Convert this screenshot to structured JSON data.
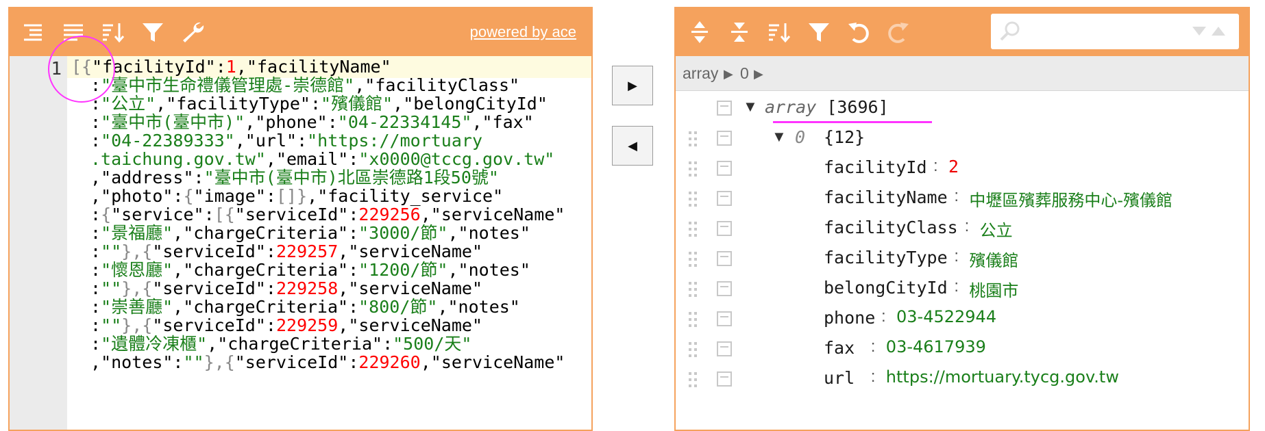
{
  "left_panel": {
    "powered_by": "powered by ace",
    "toolbar": {
      "format_icon": "format-icon",
      "compact_icon": "compact-icon",
      "sort_icon": "sort-icon",
      "filter_icon": "filter-icon",
      "repair_icon": "wrench-icon"
    },
    "line_number": "1"
  },
  "transfer": {
    "to_right": "▶",
    "to_left": "◀"
  },
  "right_panel": {
    "toolbar": {
      "expand_icon": "expand-all-icon",
      "collapse_icon": "collapse-all-icon",
      "sort_icon": "sort-icon",
      "filter_icon": "filter-icon",
      "undo_icon": "undo-icon",
      "redo_icon": "redo-icon"
    },
    "search": {
      "placeholder": "",
      "value": ""
    },
    "breadcrumb": [
      "array",
      "▶",
      "0",
      "▶"
    ],
    "tree": {
      "root": {
        "toggle": "▼",
        "name": "array",
        "count": "[3696]"
      },
      "item0": {
        "toggle": "▼",
        "index": "0",
        "count": "{12}"
      },
      "fields": [
        {
          "key": "facilityId",
          "sep": ":",
          "value": "2",
          "type": "number"
        },
        {
          "key": "facilityName",
          "sep": ":",
          "value": "中壢區殯葬服務中心-殯儀館",
          "type": "string"
        },
        {
          "key": "facilityClass",
          "sep": ":",
          "value": "公立",
          "type": "string"
        },
        {
          "key": "facilityType",
          "sep": ":",
          "value": "殯儀館",
          "type": "string"
        },
        {
          "key": "belongCityId",
          "sep": ":",
          "value": "桃園市",
          "type": "string"
        },
        {
          "key": "phone",
          "sep": ":",
          "value": "03-4522944",
          "type": "string"
        },
        {
          "key": "fax",
          "sep": ":",
          "value": "03-4617939",
          "type": "string"
        },
        {
          "key": "url",
          "sep": ":",
          "value": "https://mortuary.tycg.gov.tw",
          "type": "string"
        }
      ]
    }
  },
  "code_lines": [
    [
      [
        "[{",
        "b"
      ],
      [
        "\"facilityId\"",
        "k"
      ],
      [
        ":",
        "p"
      ],
      [
        "1",
        "n"
      ],
      [
        ",",
        "p"
      ],
      [
        "\"facilityName\"",
        "k"
      ]
    ],
    [
      [
        ":",
        "p"
      ],
      [
        "\"臺中市生命禮儀管理處-崇德館\"",
        "s"
      ],
      [
        ",",
        "p"
      ],
      [
        "\"facilityClass\"",
        "k"
      ]
    ],
    [
      [
        ":",
        "p"
      ],
      [
        "\"公立\"",
        "s"
      ],
      [
        ",",
        "p"
      ],
      [
        "\"facilityType\"",
        "k"
      ],
      [
        ":",
        "p"
      ],
      [
        "\"殯儀館\"",
        "s"
      ],
      [
        ",",
        "p"
      ],
      [
        "\"belongCityId\"",
        "k"
      ]
    ],
    [
      [
        ":",
        "p"
      ],
      [
        "\"臺中市(臺中市)\"",
        "s"
      ],
      [
        ",",
        "p"
      ],
      [
        "\"phone\"",
        "k"
      ],
      [
        ":",
        "p"
      ],
      [
        "\"04-22334145\"",
        "s"
      ],
      [
        ",",
        "p"
      ],
      [
        "\"fax\"",
        "k"
      ]
    ],
    [
      [
        ":",
        "p"
      ],
      [
        "\"04-22389333\"",
        "s"
      ],
      [
        ",",
        "p"
      ],
      [
        "\"url\"",
        "k"
      ],
      [
        ":",
        "p"
      ],
      [
        "\"https://mortuary",
        "s"
      ]
    ],
    [
      [
        ".taichung.gov.tw\"",
        "s"
      ],
      [
        ",",
        "p"
      ],
      [
        "\"email\"",
        "k"
      ],
      [
        ":",
        "p"
      ],
      [
        "\"x0000@tccg.gov.tw\"",
        "s"
      ]
    ],
    [
      [
        ",",
        "p"
      ],
      [
        "\"address\"",
        "k"
      ],
      [
        ":",
        "p"
      ],
      [
        "\"臺中市(臺中市)北區崇德路1段50號\"",
        "s"
      ]
    ],
    [
      [
        ",",
        "p"
      ],
      [
        "\"photo\"",
        "k"
      ],
      [
        ":",
        "p"
      ],
      [
        "{",
        "b"
      ],
      [
        "\"image\"",
        "k"
      ],
      [
        ":",
        "p"
      ],
      [
        "[]",
        "b"
      ],
      [
        "}",
        "b"
      ],
      [
        ",",
        "p"
      ],
      [
        "\"facility_service\"",
        "k"
      ]
    ],
    [
      [
        ":",
        "p"
      ],
      [
        "{",
        "b"
      ],
      [
        "\"service\"",
        "k"
      ],
      [
        ":",
        "p"
      ],
      [
        "[{",
        "b"
      ],
      [
        "\"serviceId\"",
        "k"
      ],
      [
        ":",
        "p"
      ],
      [
        "229256",
        "n"
      ],
      [
        ",",
        "p"
      ],
      [
        "\"serviceName\"",
        "k"
      ]
    ],
    [
      [
        ":",
        "p"
      ],
      [
        "\"景福廳\"",
        "s"
      ],
      [
        ",",
        "p"
      ],
      [
        "\"chargeCriteria\"",
        "k"
      ],
      [
        ":",
        "p"
      ],
      [
        "\"3000/節\"",
        "s"
      ],
      [
        ",",
        "p"
      ],
      [
        "\"notes\"",
        "k"
      ]
    ],
    [
      [
        ":",
        "p"
      ],
      [
        "\"\"",
        "s"
      ],
      [
        "},{",
        "b"
      ],
      [
        "\"serviceId\"",
        "k"
      ],
      [
        ":",
        "p"
      ],
      [
        "229257",
        "n"
      ],
      [
        ",",
        "p"
      ],
      [
        "\"serviceName\"",
        "k"
      ]
    ],
    [
      [
        ":",
        "p"
      ],
      [
        "\"懷恩廳\"",
        "s"
      ],
      [
        ",",
        "p"
      ],
      [
        "\"chargeCriteria\"",
        "k"
      ],
      [
        ":",
        "p"
      ],
      [
        "\"1200/節\"",
        "s"
      ],
      [
        ",",
        "p"
      ],
      [
        "\"notes\"",
        "k"
      ]
    ],
    [
      [
        ":",
        "p"
      ],
      [
        "\"\"",
        "s"
      ],
      [
        "},{",
        "b"
      ],
      [
        "\"serviceId\"",
        "k"
      ],
      [
        ":",
        "p"
      ],
      [
        "229258",
        "n"
      ],
      [
        ",",
        "p"
      ],
      [
        "\"serviceName\"",
        "k"
      ]
    ],
    [
      [
        ":",
        "p"
      ],
      [
        "\"崇善廳\"",
        "s"
      ],
      [
        ",",
        "p"
      ],
      [
        "\"chargeCriteria\"",
        "k"
      ],
      [
        ":",
        "p"
      ],
      [
        "\"800/節\"",
        "s"
      ],
      [
        ",",
        "p"
      ],
      [
        "\"notes\"",
        "k"
      ]
    ],
    [
      [
        ":",
        "p"
      ],
      [
        "\"\"",
        "s"
      ],
      [
        "},{",
        "b"
      ],
      [
        "\"serviceId\"",
        "k"
      ],
      [
        ":",
        "p"
      ],
      [
        "229259",
        "n"
      ],
      [
        ",",
        "p"
      ],
      [
        "\"serviceName\"",
        "k"
      ]
    ],
    [
      [
        ":",
        "p"
      ],
      [
        "\"遺體冷凍櫃\"",
        "s"
      ],
      [
        ",",
        "p"
      ],
      [
        "\"chargeCriteria\"",
        "k"
      ],
      [
        ":",
        "p"
      ],
      [
        "\"500/天\"",
        "s"
      ]
    ],
    [
      [
        ",",
        "p"
      ],
      [
        "\"notes\"",
        "k"
      ],
      [
        ":",
        "p"
      ],
      [
        "\"\"",
        "s"
      ],
      [
        "},{",
        "b"
      ],
      [
        "\"serviceId\"",
        "k"
      ],
      [
        ":",
        "p"
      ],
      [
        "229260",
        "n"
      ],
      [
        ",",
        "p"
      ],
      [
        "\"serviceName\"",
        "k"
      ]
    ]
  ]
}
